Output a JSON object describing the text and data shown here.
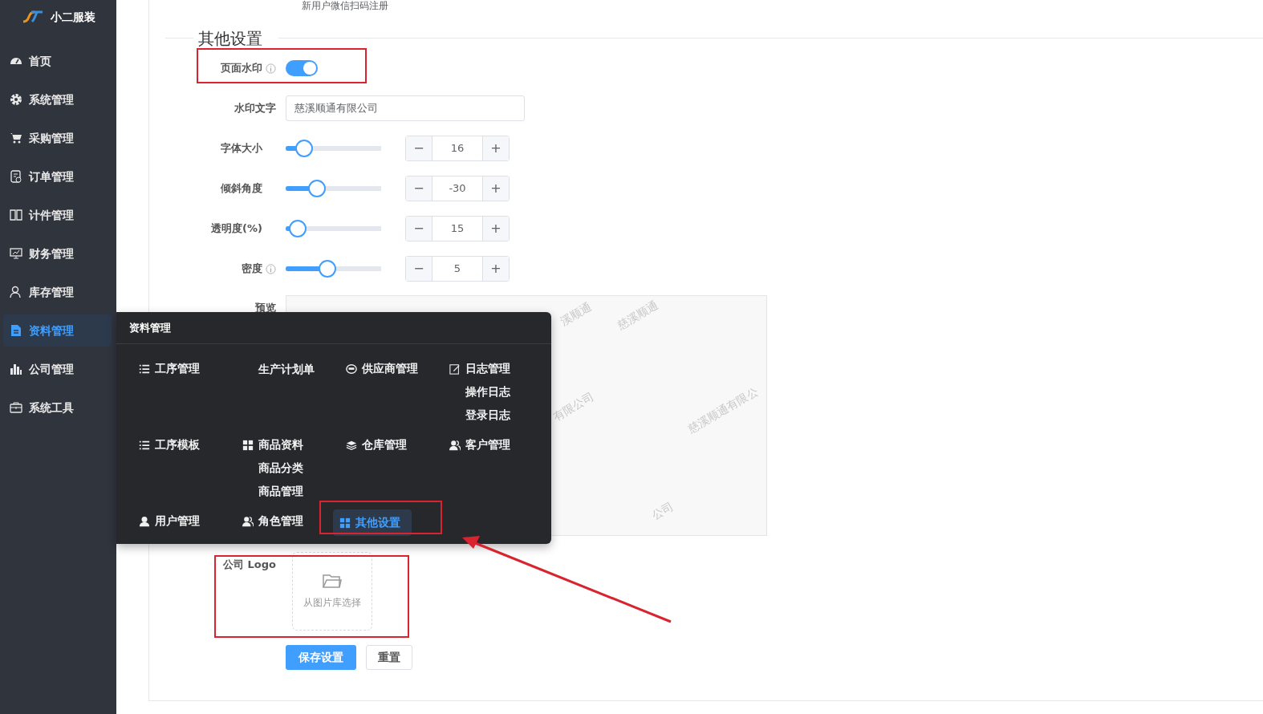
{
  "brand": {
    "name": "小二服装"
  },
  "sidebar": {
    "items": [
      {
        "label": "首页",
        "kind": "dashboard",
        "selected": false
      },
      {
        "label": "系统管理",
        "kind": "gear",
        "selected": false
      },
      {
        "label": "采购管理",
        "kind": "cart",
        "selected": false
      },
      {
        "label": "订单管理",
        "kind": "order",
        "selected": false
      },
      {
        "label": "计件管理",
        "kind": "book",
        "selected": false
      },
      {
        "label": "财务管理",
        "kind": "monitor",
        "selected": false
      },
      {
        "label": "库存管理",
        "kind": "user",
        "selected": false
      },
      {
        "label": "资料管理",
        "kind": "file",
        "selected": true
      },
      {
        "label": "公司管理",
        "kind": "bars",
        "selected": false
      },
      {
        "label": "系统工具",
        "kind": "toolbox",
        "selected": false
      }
    ]
  },
  "top_note": "新用户微信扫码注册",
  "section": {
    "title": "其他设置"
  },
  "watermark_switch": {
    "label": "页面水印",
    "on": true
  },
  "watermark_text": {
    "label": "水印文字",
    "value": "慈溪顺通有限公司"
  },
  "sliders": [
    {
      "label": "字体大小",
      "info": false,
      "level": 0.19,
      "value": "16",
      "minus": "−",
      "plus": "+"
    },
    {
      "label": "倾斜角度",
      "info": false,
      "level": 0.33,
      "value": "-30",
      "minus": "−",
      "plus": "+"
    },
    {
      "label": "透明度(%)",
      "info": false,
      "level": 0.13,
      "value": "15",
      "minus": "−",
      "plus": "+"
    },
    {
      "label": "密度",
      "info": true,
      "level": 0.44,
      "value": "5",
      "minus": "−",
      "plus": "+"
    }
  ],
  "preview": {
    "label": "预览",
    "marks": [
      "溪顺通",
      "慈溪顺通",
      "有限公司",
      "慈溪顺通有限公",
      "公司"
    ]
  },
  "logo": {
    "label": "公司 Logo",
    "picker": "从图片库选择"
  },
  "buttons": [
    {
      "label": "保存设置",
      "kind": "primary"
    },
    {
      "label": "重置",
      "kind": "default"
    }
  ],
  "menu": {
    "title": "资料管理",
    "rows": [
      [
        {
          "label": "工序管理",
          "kind": "list",
          "selected": false
        },
        {
          "label": "生产计划单",
          "kind": "none",
          "selected": false
        },
        {
          "label": "供应商管理",
          "kind": "robot",
          "selected": false
        },
        {
          "label": "日志管理",
          "kind": "edit",
          "selected": false,
          "children": [
            {
              "label": "操作日志"
            },
            {
              "label": "登录日志"
            }
          ]
        }
      ],
      [
        {
          "label": "工序模板",
          "kind": "list",
          "selected": false
        },
        {
          "label": "商品资料",
          "kind": "grid",
          "selected": false,
          "children": [
            {
              "label": "商品分类"
            },
            {
              "label": "商品管理"
            }
          ]
        },
        {
          "label": "仓库管理",
          "kind": "layers",
          "selected": false
        },
        {
          "label": "客户管理",
          "kind": "users",
          "selected": false
        }
      ],
      [
        {
          "label": "用户管理",
          "kind": "user",
          "selected": false
        },
        {
          "label": "角色管理",
          "kind": "users",
          "selected": false
        },
        {
          "label": "其他设置",
          "kind": "grid",
          "selected": true
        }
      ]
    ]
  }
}
